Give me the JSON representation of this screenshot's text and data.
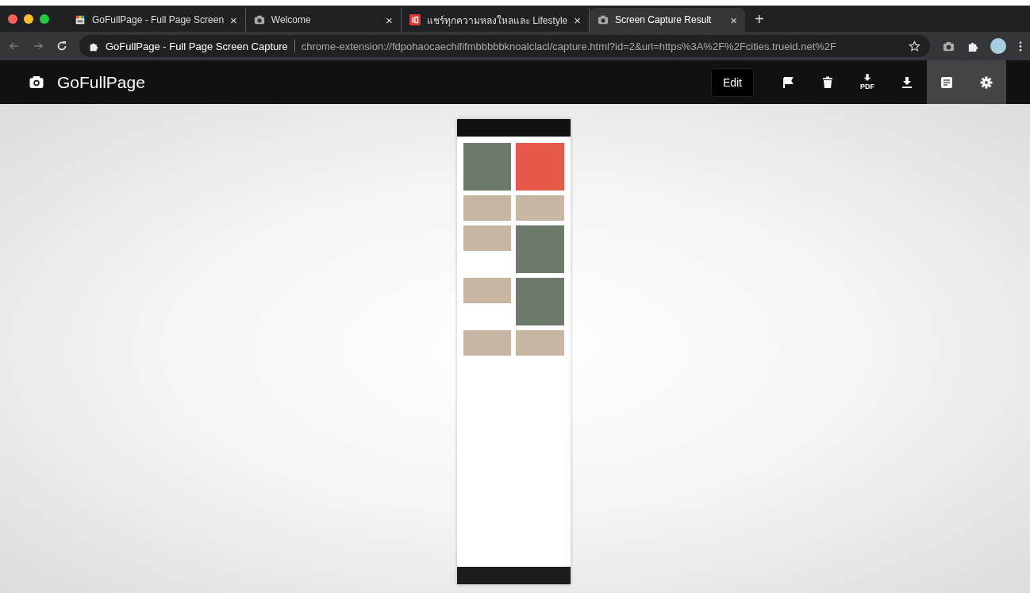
{
  "browser": {
    "tabs": [
      {
        "title": "GoFullPage - Full Page Screen",
        "kind": "gofullpage",
        "close": "×",
        "selected": false
      },
      {
        "title": "Welcome",
        "kind": "camera",
        "close": "×",
        "selected": false
      },
      {
        "title": "แชร์ทุกความหลงใหลและ Lifestyle",
        "kind": "trueid",
        "close": "×",
        "selected": false
      },
      {
        "title": "Screen Capture Result",
        "kind": "camera",
        "close": "×",
        "selected": true
      }
    ],
    "new_tab": "+",
    "site_name": "GoFullPage - Full Page Screen Capture",
    "url": "chrome-extension://fdpohaocaechififmbbbbbknoalclacl/capture.html?id=2&url=https%3A%2F%2Fcities.trueid.net%2F"
  },
  "app": {
    "title": "GoFullPage",
    "edit_button": "Edit",
    "tools": [
      {
        "kind": "flag",
        "selected": false
      },
      {
        "kind": "trash",
        "selected": false
      },
      {
        "kind": "pdf",
        "label": "PDF",
        "selected": false
      },
      {
        "kind": "download",
        "selected": false
      },
      {
        "kind": "notes",
        "selected": true
      },
      {
        "kind": "settings",
        "selected": true
      }
    ]
  }
}
